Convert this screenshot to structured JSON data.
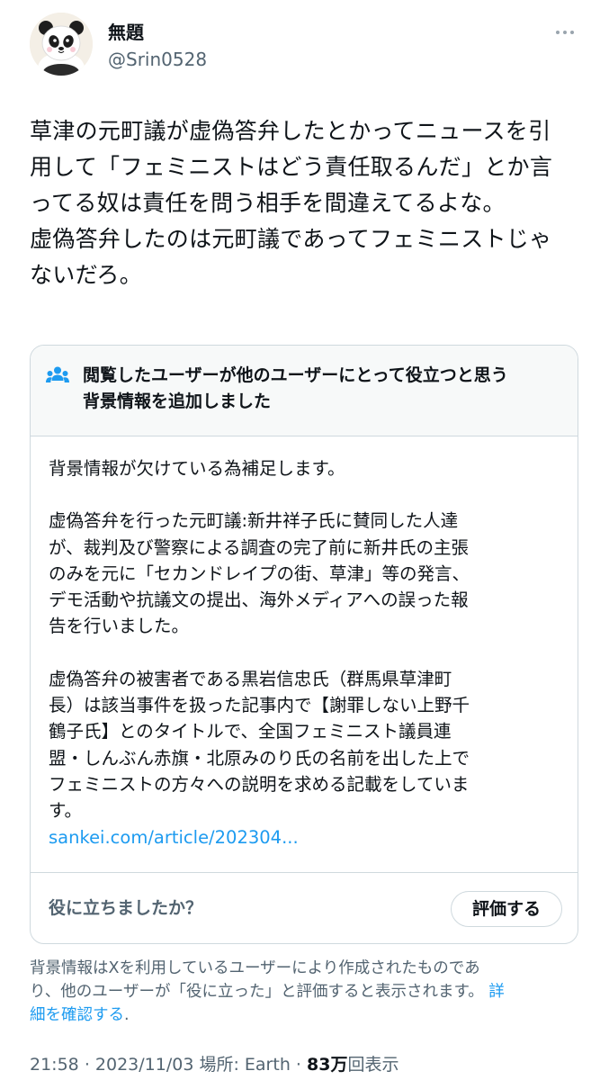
{
  "author": {
    "display_name": "無題",
    "handle": "@Srin0528",
    "avatar_icon": "panda-avatar"
  },
  "tweet": {
    "lines": [
      "草津の元町議が虚偽答弁したとかってニュースを引",
      "用して「フェミニストはどう責任取るんだ」とか言",
      "ってる奴は責任を問う相手を間違えてるよな。",
      "虚偽答弁したのは元町議であってフェミニストじゃ",
      "ないだろ。"
    ]
  },
  "community_note": {
    "header_lines": [
      "閲覧したユーザーが他のユーザーにとって役立つと思う",
      "背景情報を追加しました"
    ],
    "paragraph1": [
      "背景情報が欠けている為補足します。"
    ],
    "paragraph2": [
      "虚偽答弁を行った元町議:新井祥子氏に賛同した人達",
      "が、裁判及び警察による調査の完了前に新井氏の主張",
      "のみを元に「セカンドレイプの街、草津」等の発言、",
      "デモ活動や抗議文の提出、海外メディアへの誤った報",
      "告を行いました。"
    ],
    "paragraph3": [
      "虚偽答弁の被害者である黒岩信忠氏（群馬県草津町",
      "長）は該当事件を扱った記事内で【謝罪しない上野千",
      "鶴子氏】とのタイトルで、全国フェミニスト議員連",
      "盟・しんぶん赤旗・北原みのり氏の名前を出した上で",
      "フェミニストの方々への説明を求める記載をしていま",
      "す。"
    ],
    "link_text": "sankei.com/article/202304...",
    "helpful_question": "役に立ちましたか？",
    "rate_button": "評価する"
  },
  "disclaimer": {
    "line1": "背景情報はXを利用しているユーザーにより作成されたものであ",
    "line2_text": "り、他のユーザーが「役に立った」と評価すると表示されます。",
    "line2_link": "詳",
    "line3_link": "細を確認する",
    "line3_tail": "."
  },
  "meta": {
    "time": "21:58",
    "sep": "·",
    "date": "2023/11/03",
    "location": "場所: Earth",
    "views_count": "83万",
    "views_label": "回表示"
  },
  "colors": {
    "text": "#0f1419",
    "secondary": "#536471",
    "link": "#1d9bf0",
    "border": "#cfd9de",
    "note_header_bg": "#f7f9f9"
  }
}
